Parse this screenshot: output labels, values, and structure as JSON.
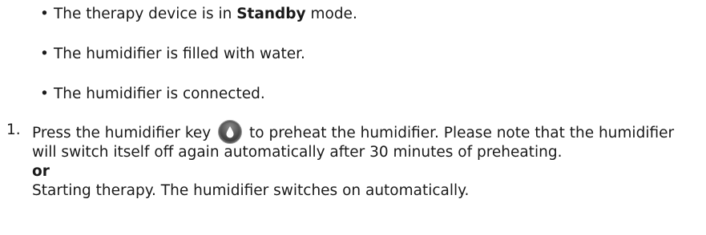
{
  "bullets": [
    {
      "marker": "•",
      "before": "The therapy device is in ",
      "bold": "Standby",
      "after": " mode."
    },
    {
      "marker": "•",
      "text": "The humidifier is filled with water."
    },
    {
      "marker": "•",
      "text": "The humidifier is connected."
    }
  ],
  "step": {
    "number": "1.",
    "text_before_icon": "Press the humidifier key",
    "icon": "humidifier-key-icon",
    "text_after_icon": "to preheat the humidifier. Please note that the humidifier will switch itself off again automatically after 30 minutes of preheating.",
    "or_word": "or",
    "alternative": "Starting therapy. The humidifier switches on automatically."
  },
  "colors": {
    "text": "#1a1a1a",
    "key_dark": "#2b2b2b",
    "key_light": "#8e8e8e"
  }
}
